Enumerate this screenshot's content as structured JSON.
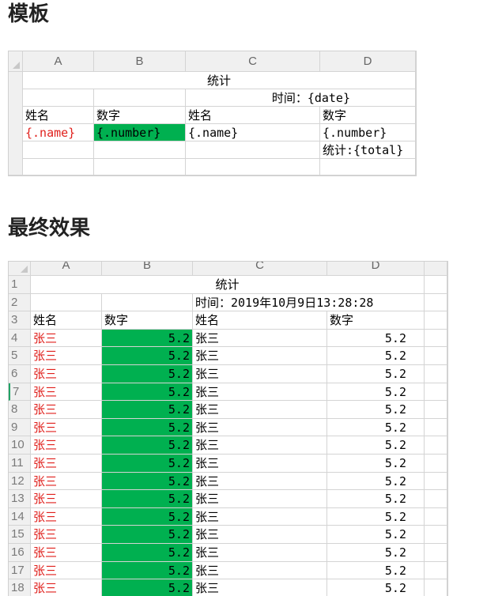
{
  "headings": {
    "template": "模板",
    "result": "最终效果"
  },
  "template_sheet": {
    "columns": [
      "A",
      "B",
      "C",
      "D"
    ],
    "rows": [
      {
        "merged_title": "统计"
      },
      {
        "D_time": "时间：{date}"
      },
      {
        "A": "姓名",
        "B": "数字",
        "C": "姓名",
        "D": "数字"
      },
      {
        "A": "{.name}",
        "B": "{.number}",
        "C": "{.name}",
        "D": "{.number}"
      },
      {
        "D": "统计:{total}"
      },
      {}
    ]
  },
  "result_sheet": {
    "columns": [
      "A",
      "B",
      "C",
      "D"
    ],
    "row_numbers": [
      "1",
      "2",
      "3",
      "4",
      "5",
      "6",
      "7",
      "8",
      "9",
      "10",
      "11",
      "12",
      "13",
      "14",
      "15",
      "16",
      "17",
      "18"
    ],
    "title": "统计",
    "time": "时间：2019年10月9日13:28:28",
    "header": {
      "A": "姓名",
      "B": "数字",
      "C": "姓名",
      "D": "数字"
    },
    "data_rows": [
      {
        "A": "张三",
        "B": "5.2",
        "C": "张三",
        "D": "5.2"
      },
      {
        "A": "张三",
        "B": "5.2",
        "C": "张三",
        "D": "5.2"
      },
      {
        "A": "张三",
        "B": "5.2",
        "C": "张三",
        "D": "5.2"
      },
      {
        "A": "张三",
        "B": "5.2",
        "C": "张三",
        "D": "5.2"
      },
      {
        "A": "张三",
        "B": "5.2",
        "C": "张三",
        "D": "5.2"
      },
      {
        "A": "张三",
        "B": "5.2",
        "C": "张三",
        "D": "5.2"
      },
      {
        "A": "张三",
        "B": "5.2",
        "C": "张三",
        "D": "5.2"
      },
      {
        "A": "张三",
        "B": "5.2",
        "C": "张三",
        "D": "5.2"
      },
      {
        "A": "张三",
        "B": "5.2",
        "C": "张三",
        "D": "5.2"
      },
      {
        "A": "张三",
        "B": "5.2",
        "C": "张三",
        "D": "5.2"
      },
      {
        "A": "张三",
        "B": "5.2",
        "C": "张三",
        "D": "5.2"
      },
      {
        "A": "张三",
        "B": "5.2",
        "C": "张三",
        "D": "5.2"
      },
      {
        "A": "张三",
        "B": "5.2",
        "C": "张三",
        "D": "5.2"
      },
      {
        "A": "张三",
        "B": "5.2",
        "C": "张三",
        "D": "5.2"
      },
      {
        "A": "张三",
        "B": "5.2",
        "C": "张三",
        "D": "5.2"
      }
    ]
  },
  "colors": {
    "green_fill": "#00b050",
    "red_text": "#e0201c",
    "header_bg": "#f0f0f0"
  }
}
